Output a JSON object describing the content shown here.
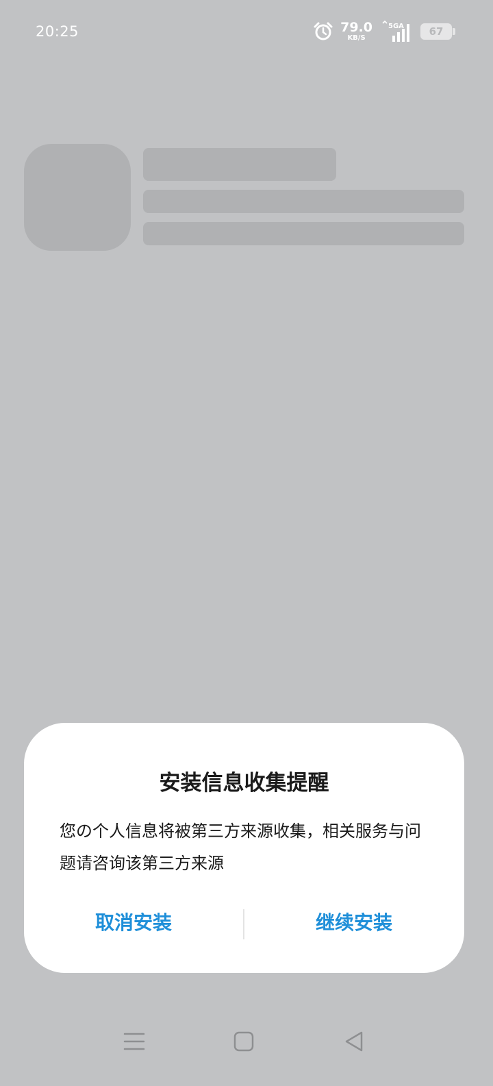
{
  "status_bar": {
    "time": "20:25",
    "net_speed_value": "79.0",
    "net_speed_unit": "KB/S",
    "network_type": "5GA",
    "battery_level": "67"
  },
  "dialog": {
    "title": "安装信息收集提醒",
    "message": "您の个人信息将被第三方来源收集，相关服务与问题请咨询该第三方来源",
    "cancel_label": "取消安装",
    "continue_label": "继续安装"
  },
  "colors": {
    "scrim": "#c1c2c4",
    "skeleton": "#b0b1b3",
    "accent": "#1f8fd9",
    "dialog_bg": "#ffffff"
  },
  "icons": {
    "alarm": "alarm-icon",
    "signal": "signal-icon",
    "battery": "battery-icon",
    "menu": "menu-icon",
    "home": "home-icon",
    "back": "back-icon"
  }
}
